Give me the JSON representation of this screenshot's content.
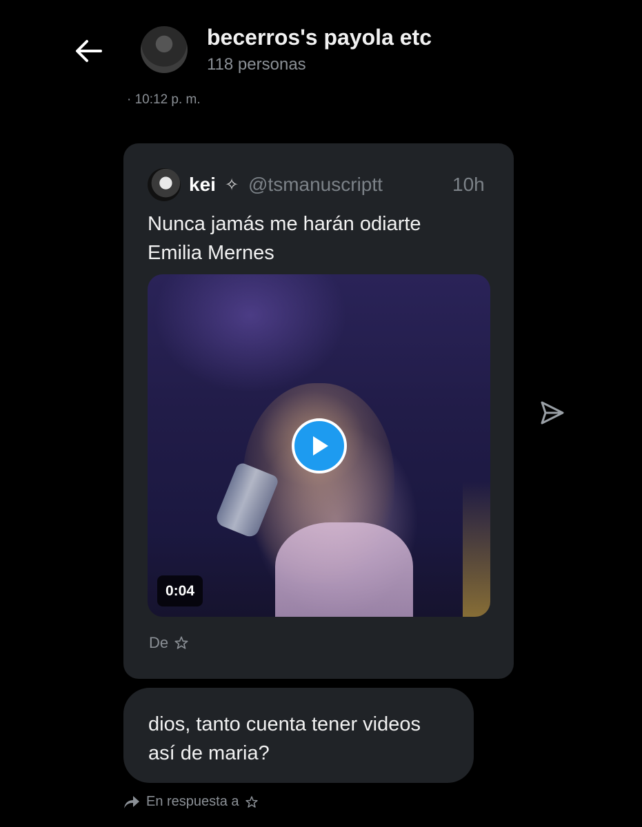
{
  "header": {
    "back_icon": "arrow-left-icon",
    "title": "becerros's payola etc",
    "subtitle": "118 personas",
    "avatar_icon": "group-avatar"
  },
  "timestamp": "· 10:12 p. m.",
  "quoted_post": {
    "author_name": "kei",
    "verified_glyph": "✧",
    "handle": "@tsmanuscriptt",
    "time": "10h",
    "text_line1": "Nunca jamás me harán odiarte",
    "text_line2": "Emilia Mernes",
    "media": {
      "type": "video",
      "duration": "0:04",
      "play_icon": "play-icon"
    },
    "source_prefix": "De",
    "source_icon": "star-icon"
  },
  "send_icon": "send-icon",
  "message": {
    "line1": "dios, tanto cuenta tener videos",
    "line2": "así de maria?"
  },
  "reply_context": {
    "label": "En respuesta a",
    "reply_icon": "reply-arrow-icon",
    "star_icon": "star-icon"
  },
  "colors": {
    "background": "#000000",
    "card": "#202327",
    "muted_text": "#8b9096",
    "accent": "#1d9bf0"
  }
}
